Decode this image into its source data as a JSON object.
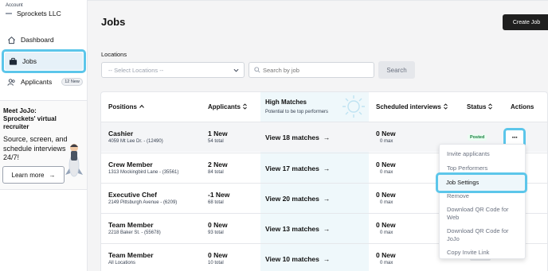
{
  "account": {
    "label": "Account",
    "name": "Sprockets LLC"
  },
  "nav": [
    {
      "label": "Dashboard"
    },
    {
      "label": "Jobs"
    },
    {
      "label": "Applicants",
      "badge": "12 New"
    }
  ],
  "promo": {
    "title": "Meet JoJo: Sprockets' virtual recruiter",
    "body": "Source, screen, and schedule interviews 24/7!",
    "button": "Learn more",
    "button_arrow": "→"
  },
  "page": {
    "title": "Jobs",
    "create_button": "Create Job"
  },
  "filters": {
    "locations_label": "Locations",
    "locations_placeholder": "-- Select Locations --",
    "search_placeholder": "Search by job",
    "search_button": "Search"
  },
  "table": {
    "headers": {
      "positions": "Positions",
      "applicants": "Applicants",
      "high_matches": "High Matches",
      "high_matches_sub": "Potential to be top performers",
      "scheduled": "Scheduled interviews",
      "status": "Status",
      "actions": "Actions"
    },
    "rows": [
      {
        "title": "Cashier",
        "address": "4059 Mt Lee Dr. - (12490)",
        "applicants_new": "1 New",
        "applicants_total": "54 total",
        "matches": "View 18 matches",
        "sched_new": "0 New",
        "sched_max": "0 max",
        "status": "Posted"
      },
      {
        "title": "Crew Member",
        "address": "1313 Mockingbird Lane - (35561)",
        "applicants_new": "2 New",
        "applicants_total": "84 total",
        "matches": "View 17 matches",
        "sched_new": "0 New",
        "sched_max": "0 max",
        "status": ""
      },
      {
        "title": "Executive Chef",
        "address": "2149 Pittsburgh Avenue - (6209)",
        "applicants_new": "-1 New",
        "applicants_total": "68 total",
        "matches": "View 20 matches",
        "sched_new": "0 New",
        "sched_max": "0 max",
        "status": ""
      },
      {
        "title": "Team Member",
        "address": "2218 Baker St. - (55678)",
        "applicants_new": "0 New",
        "applicants_total": "93 total",
        "matches": "View 13 matches",
        "sched_new": "0 New",
        "sched_max": "0 max",
        "status": ""
      },
      {
        "title": "Team Member",
        "address": "All Locations",
        "applicants_new": "0 New",
        "applicants_total": "10 total",
        "matches": "View 10 matches",
        "sched_new": "0 New",
        "sched_max": "0 max",
        "status": ""
      }
    ],
    "actions_button": "···",
    "arrow": "→"
  },
  "menu": {
    "items": [
      "Invite applicants",
      "Top Performers",
      "Job Settings",
      "Remove",
      "Download QR Code for Web",
      "Download QR Code for JoJo",
      "Copy Invite Link"
    ]
  },
  "colors": {
    "highlight": "#5cc6ea",
    "posted_green": "#15803d",
    "create_bg": "#1f1f1f"
  }
}
